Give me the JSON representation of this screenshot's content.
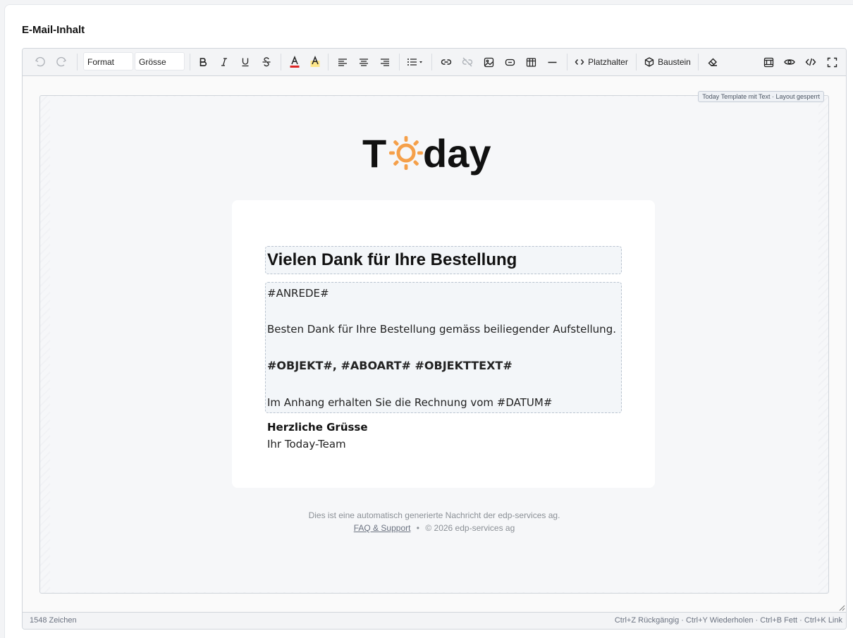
{
  "section": {
    "title": "E-Mail-Inhalt"
  },
  "toolbar": {
    "format_select": "Format",
    "size_select": "Grösse",
    "placeholder_label": "Platzhalter",
    "block_label": "Baustein",
    "text_color": "#dc2626",
    "highlight_color": "#fde047",
    "icons": [
      "undo-icon",
      "redo-icon",
      "bold-icon",
      "italic-icon",
      "underline-icon",
      "strikethrough-icon",
      "text-color-icon",
      "highlight-icon",
      "align-left-icon",
      "align-center-icon",
      "align-right-icon",
      "list-icon",
      "link-icon",
      "unlink-icon",
      "image-icon",
      "button-icon",
      "table-icon",
      "horizontal-rule-icon",
      "code-icon",
      "cube-icon",
      "eraser-icon",
      "template-icon",
      "eye-icon",
      "source-code-icon",
      "fullscreen-icon"
    ]
  },
  "canvas": {
    "lock_badge": "Today Template mit Text · Layout gesperrt",
    "logo": {
      "text_before": "T",
      "text_after": "day",
      "sun_color": "#f5a04a"
    },
    "email": {
      "heading": "Vielen Dank für Ihre Bestellung",
      "lines": [
        "#ANREDE#",
        "Besten Dank für Ihre Bestellung gemäss beiliegender Aufstellung.",
        "#OBJEKT#, #ABOART# #OBJEKTTEXT#",
        "Im Anhang erhalten Sie die Rechnung vom #DATUM#"
      ],
      "signature_greeting": "Herzliche Grüsse",
      "signature_team": "Ihr Today-Team"
    },
    "footer": {
      "note": "Dies ist eine automatisch generierte Nachricht der edp-services ag.",
      "link": "FAQ & Support",
      "separator": "•",
      "copyright": "© 2026 edp-services ag"
    }
  },
  "status": {
    "char_count": "1548 Zeichen",
    "shortcuts": "Ctrl+Z Rückgängig · Ctrl+Y Wiederholen · Ctrl+B Fett · Ctrl+K Link"
  }
}
